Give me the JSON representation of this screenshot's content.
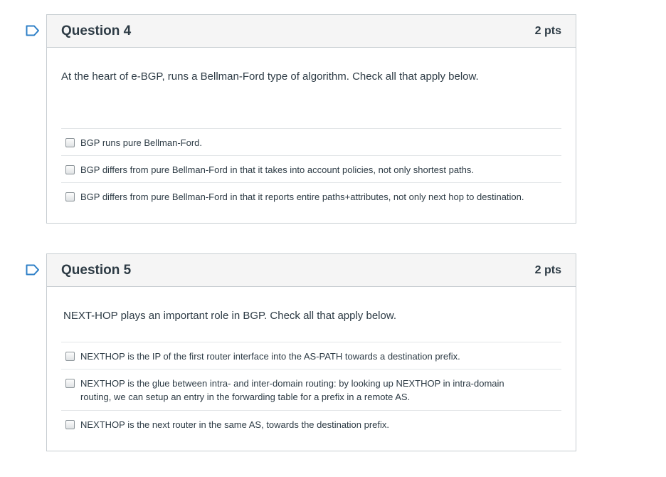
{
  "questions": [
    {
      "title": "Question 4",
      "points": "2 pts",
      "text": "At the heart of e-BGP, runs a Bellman-Ford type of algorithm. Check all that apply below.",
      "answers": [
        "BGP runs pure Bellman-Ford.",
        "BGP differs from pure Bellman-Ford in that it takes into account policies, not only shortest paths.",
        "BGP differs from pure Bellman-Ford in that it reports entire paths+attributes, not only next hop to destination."
      ]
    },
    {
      "title": "Question 5",
      "points": "2 pts",
      "text": "NEXT-HOP plays an important role in BGP. Check all that apply below.",
      "answers": [
        "NEXTHOP is the IP of the first router interface into the AS-PATH towards a destination prefix.",
        "NEXTHOP is the glue between intra- and inter-domain routing: by looking up NEXTHOP in intra-domain routing, we can setup an entry in the forwarding table for a prefix in a remote AS.",
        "NEXTHOP is the next router in the same AS, towards the destination prefix."
      ]
    }
  ],
  "colors": {
    "flag": "#2d7fc7",
    "border": "#c7cdd1",
    "header_bg": "#f5f5f5",
    "text": "#2d3b45"
  },
  "icons": {
    "flag": "bookmark-flag-icon",
    "checkbox": "checkbox-icon"
  }
}
